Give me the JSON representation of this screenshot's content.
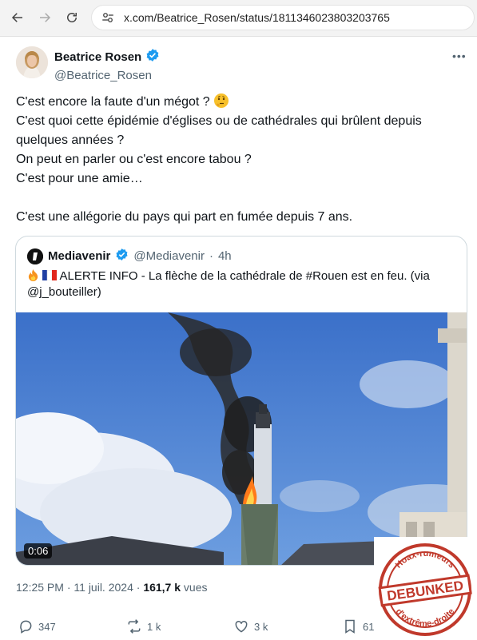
{
  "browser": {
    "url": "x.com/Beatrice_Rosen/status/1811346023803203765"
  },
  "tweet": {
    "author_name": "Beatrice Rosen",
    "author_handle": "@Beatrice_Rosen",
    "lines": [
      "C'est encore la faute d'un mégot ?",
      "C'est quoi cette épidémie d'églises ou de cathédrales qui brûlent depuis",
      "quelques années ?",
      "On peut en parler ou c'est encore tabou ?",
      "C'est pour une amie…",
      "",
      "C'est une allégorie du pays qui part en fumée depuis 7 ans."
    ],
    "time": "12:25 PM",
    "date": "11 juil. 2024",
    "views": "161,7 k",
    "views_label": "vues"
  },
  "quote": {
    "name": "Mediavenir",
    "handle": "@Mediavenir",
    "age": "4h",
    "text_line1": "ALERTE INFO -  La flèche de la cathédrale de #Rouen est en feu. (via",
    "text_line2": "@j_bouteiller)",
    "video_duration": "0:06"
  },
  "actions": {
    "replies": "347",
    "reposts": "1 k",
    "likes": "3 k",
    "bookmarks": "61"
  },
  "stamp": {
    "top_text": "Hoax-rumeurs",
    "center_text": "DEBUNKED",
    "bottom_text": "d'extrême-droite"
  },
  "colors": {
    "verified": "#1d9bf0",
    "text": "#0f1419",
    "secondary": "#536471",
    "stamp_red": "#c0392b"
  }
}
